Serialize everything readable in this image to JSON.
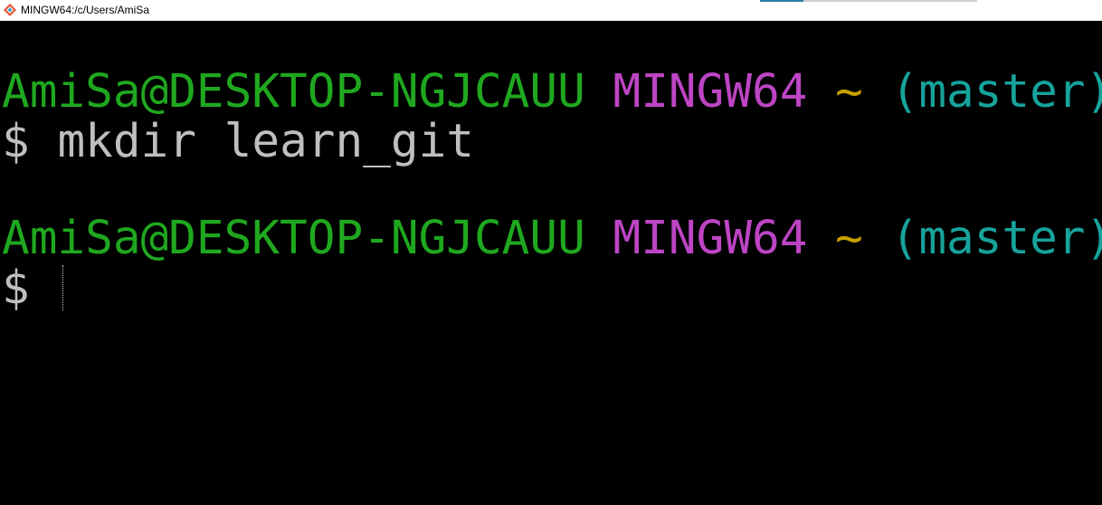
{
  "window": {
    "title": "MINGW64:/c/Users/AmiSa",
    "icon": "git-bash-icon"
  },
  "terminal": {
    "colors": {
      "background": "#000000",
      "user_host": "#1fa81f",
      "system": "#bd45c4",
      "path": "#c8a000",
      "branch": "#17a39b",
      "text": "#bfbfbf"
    },
    "prompts": [
      {
        "user_host": "AmiSa@DESKTOP-NGJCAUU",
        "system": "MINGW64",
        "path": "~",
        "branch": "(master)",
        "symbol": "$",
        "command": "mkdir learn_git"
      },
      {
        "user_host": "AmiSa@DESKTOP-NGJCAUU",
        "system": "MINGW64",
        "path": "~",
        "branch": "(master)",
        "symbol": "$",
        "command": ""
      }
    ]
  }
}
